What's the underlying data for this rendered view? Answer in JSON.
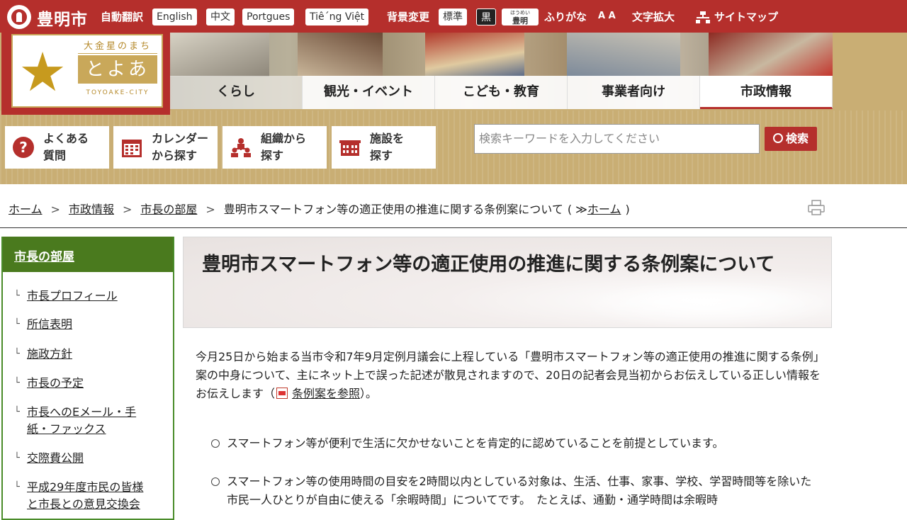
{
  "topbar": {
    "city_name": "豊明市",
    "auto_translate": "自動翻訳",
    "languages": [
      "English",
      "中文",
      "Portgues",
      "Tiê´ng Việt"
    ],
    "bg_change": "背景変更",
    "bg_standard": "標準",
    "bg_black": "黒",
    "furigana_icon_top": "ほうめい",
    "furigana_icon_main": "豊明",
    "furigana": "ふりがな",
    "text_size_icon": "A A",
    "text_size": "文字拡大",
    "sitemap": "サイトマップ",
    "colors": {
      "brand": "#b52f2c",
      "gold": "#c9ae74"
    }
  },
  "logo": {
    "tagline": "大金星のまち",
    "main": "とよあけ",
    "english": "TOYOAKE-CITY",
    "star": "★"
  },
  "nav": {
    "items": [
      "くらし",
      "観光・イベント",
      "こども・教育",
      "事業者向け",
      "市政情報"
    ],
    "active": "市政情報"
  },
  "quick": {
    "faq": "よくある\n質問",
    "calendar": "カレンダー\nから探す",
    "org": "組織から\n探す",
    "facility": "施設を\n探す"
  },
  "search": {
    "placeholder": "検索キーワードを入力してください",
    "button": "検索"
  },
  "breadcrumb": {
    "home": "ホーム",
    "sep": ">",
    "gov": "市政情報",
    "mayor": "市長の部屋",
    "current": "豊明市スマートフォン等の適正使用の推進に関する条例案について",
    "alt_prefix": "( ≫",
    "alt_home": "ホーム",
    "alt_suffix": ")"
  },
  "sidebar": {
    "title": "市長の部屋",
    "mark": "└",
    "items": [
      "市長プロフィール",
      "所信表明",
      "施政方針",
      "市長の予定",
      "市長へのEメール・手紙・ファックス",
      "交際費公開",
      "平成29年度市民の皆様と市長との意見交換会"
    ]
  },
  "main": {
    "title": "豊明市スマートフォン等の適正使用の推進に関する条例案について",
    "intro_text": "今月25日から始まる当市令和7年9月定例月議会に上程している「豊明市スマートフォン等の適正使用の推進に関する条例」案の中身について、主にネット上で誤った記述が散見されますので、20日の記者会見当初からお伝えしている正しい情報をお伝えします（",
    "intro_link": "条例案を参照",
    "intro_end": "）。",
    "bullets": [
      "スマートフォン等が便利で生活に欠かせないことを肯定的に認めていることを前提としています。",
      "スマートフォン等の使用時間の目安を2時間以内としている対象は、生活、仕事、家事、学校、学習時間等を除いた市民一人ひとりが自由に使える「余暇時間」についてです。　たとえば、通勤・通学時間は余暇時"
    ]
  }
}
